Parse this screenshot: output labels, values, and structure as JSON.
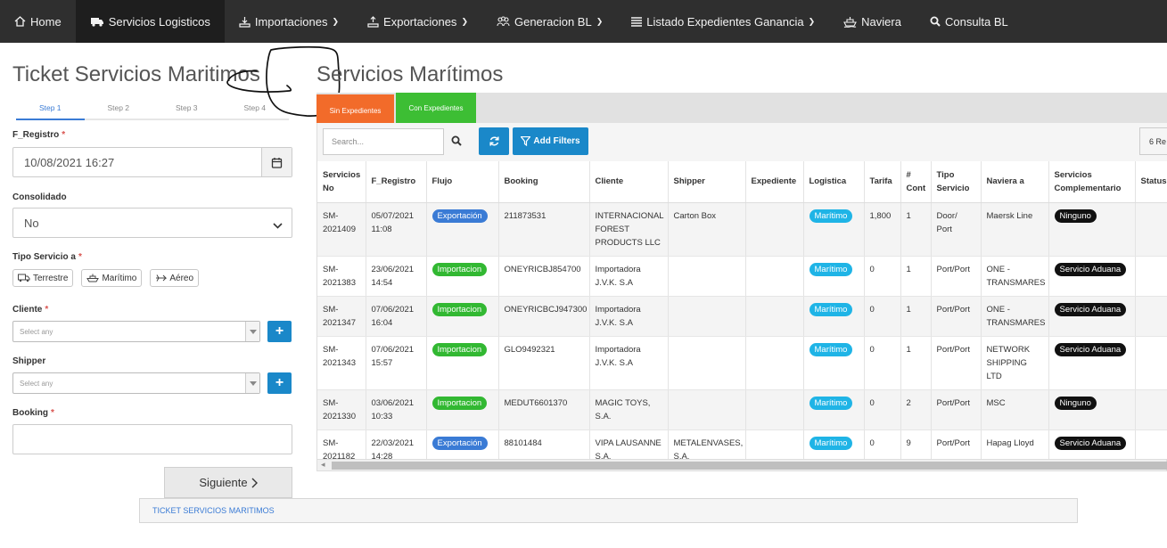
{
  "nav": {
    "items": [
      {
        "label": "Home",
        "icon": "home-icon"
      },
      {
        "label": "Servicios Logisticos",
        "icon": "truck-icon"
      },
      {
        "label": "Importaciones",
        "icon": "import-icon"
      },
      {
        "label": "Exportaciones",
        "icon": "export-icon"
      },
      {
        "label": "Generacion BL",
        "icon": "users-icon"
      },
      {
        "label": "Listado Expedientes Ganancia",
        "icon": "list-icon"
      },
      {
        "label": "Naviera",
        "icon": "ship-icon"
      },
      {
        "label": "Consulta BL",
        "icon": "search-icon"
      }
    ]
  },
  "left": {
    "title": "Ticket Servicios Maritimos",
    "steps": [
      "Step 1",
      "Step 2",
      "Step 3",
      "Step 4"
    ],
    "f_registro": {
      "label": "F_Registro",
      "value": "10/08/2021 16:27"
    },
    "consolidado": {
      "label": "Consolidado",
      "value": "No"
    },
    "tipo_servicio": {
      "label": "Tipo Servicio a",
      "options": [
        "Terrestre",
        "Marítimo",
        "Aéreo"
      ]
    },
    "cliente": {
      "label": "Cliente",
      "placeholder": "Select any"
    },
    "shipper": {
      "label": "Shipper",
      "placeholder": "Select any"
    },
    "booking": {
      "label": "Booking",
      "value": ""
    },
    "next_label": "Siguiente"
  },
  "footer": {
    "breadcrumb": "TICKET SERVICIOS MARITIMOS"
  },
  "right": {
    "title": "Servicios Marítimos",
    "tabs": [
      "Sin Expedientes",
      "Con Expedientes"
    ],
    "search_placeholder": "Search...",
    "add_filters_label": "Add Filters",
    "records_label": "6 Re"
  },
  "table": {
    "columns": [
      "Servicios No",
      "F_Registro",
      "Flujo",
      "Booking",
      "Cliente",
      "Shipper",
      "Expediente",
      "Logistica",
      "Tarifa",
      "# Cont",
      "Tipo Servicio",
      "Naviera a",
      "Servicios Complementario",
      "Status Exped"
    ],
    "rows": [
      {
        "no": "SM-2021409",
        "fecha": "05/07/2021 11:08",
        "flujo": "Exportación",
        "booking": "211873531",
        "cliente": "INTERNACIONAL FOREST PRODUCTS LLC",
        "shipper": "Carton Box",
        "expediente": "",
        "logistica": "Marítimo",
        "tarifa": "1,800",
        "cont": "1",
        "tipo": "Door/ Port",
        "naviera": "Maersk Line",
        "servicios": "Ninguno"
      },
      {
        "no": "SM-2021383",
        "fecha": "23/06/2021 14:54",
        "flujo": "Importacion",
        "booking": "ONEYRICBJ854700",
        "cliente": "Importadora J.V.K. S.A",
        "shipper": "",
        "expediente": "",
        "logistica": "Marítimo",
        "tarifa": "0",
        "cont": "1",
        "tipo": "Port/Port",
        "naviera": "ONE - TRANSMARES",
        "servicios": "Servicio Aduana"
      },
      {
        "no": "SM-2021347",
        "fecha": "07/06/2021 16:04",
        "flujo": "Importacion",
        "booking": "ONEYRICBCJ947300",
        "cliente": "Importadora J.V.K. S.A",
        "shipper": "",
        "expediente": "",
        "logistica": "Marítimo",
        "tarifa": "0",
        "cont": "1",
        "tipo": "Port/Port",
        "naviera": "ONE - TRANSMARES",
        "servicios": "Servicio Aduana"
      },
      {
        "no": "SM-2021343",
        "fecha": "07/06/2021 15:57",
        "flujo": "Importacion",
        "booking": "GLO9492321",
        "cliente": "Importadora J.V.K. S.A",
        "shipper": "",
        "expediente": "",
        "logistica": "Marítimo",
        "tarifa": "0",
        "cont": "1",
        "tipo": "Port/Port",
        "naviera": "NETWORK SHIPPING LTD",
        "servicios": "Servicio Aduana"
      },
      {
        "no": "SM-2021330",
        "fecha": "03/06/2021 10:33",
        "flujo": "Importacion",
        "booking": "MEDUT6601370",
        "cliente": "MAGIC TOYS, S.A.",
        "shipper": "",
        "expediente": "",
        "logistica": "Marítimo",
        "tarifa": "0",
        "cont": "2",
        "tipo": "Port/Port",
        "naviera": "MSC",
        "servicios": "Ninguno"
      },
      {
        "no": "SM-2021182",
        "fecha": "22/03/2021 14:28",
        "flujo": "Exportación",
        "booking": "88101484",
        "cliente": "VIPA LAUSANNE S.A.",
        "shipper": "METALENVASES, S.A.",
        "expediente": "",
        "logistica": "Marítimo",
        "tarifa": "0",
        "cont": "9",
        "tipo": "Port/Port",
        "naviera": "Hapag Lloyd",
        "servicios": "Servicio Aduana"
      }
    ]
  },
  "colors": {
    "navbar": "#2f2f2f",
    "accent": "#1a88c9",
    "tab_sin": "#f26b2a",
    "tab_con": "#3dbe34",
    "pill_exp": "#3a7bd5",
    "pill_imp": "#32b832",
    "pill_mar": "#1fb4e6"
  }
}
